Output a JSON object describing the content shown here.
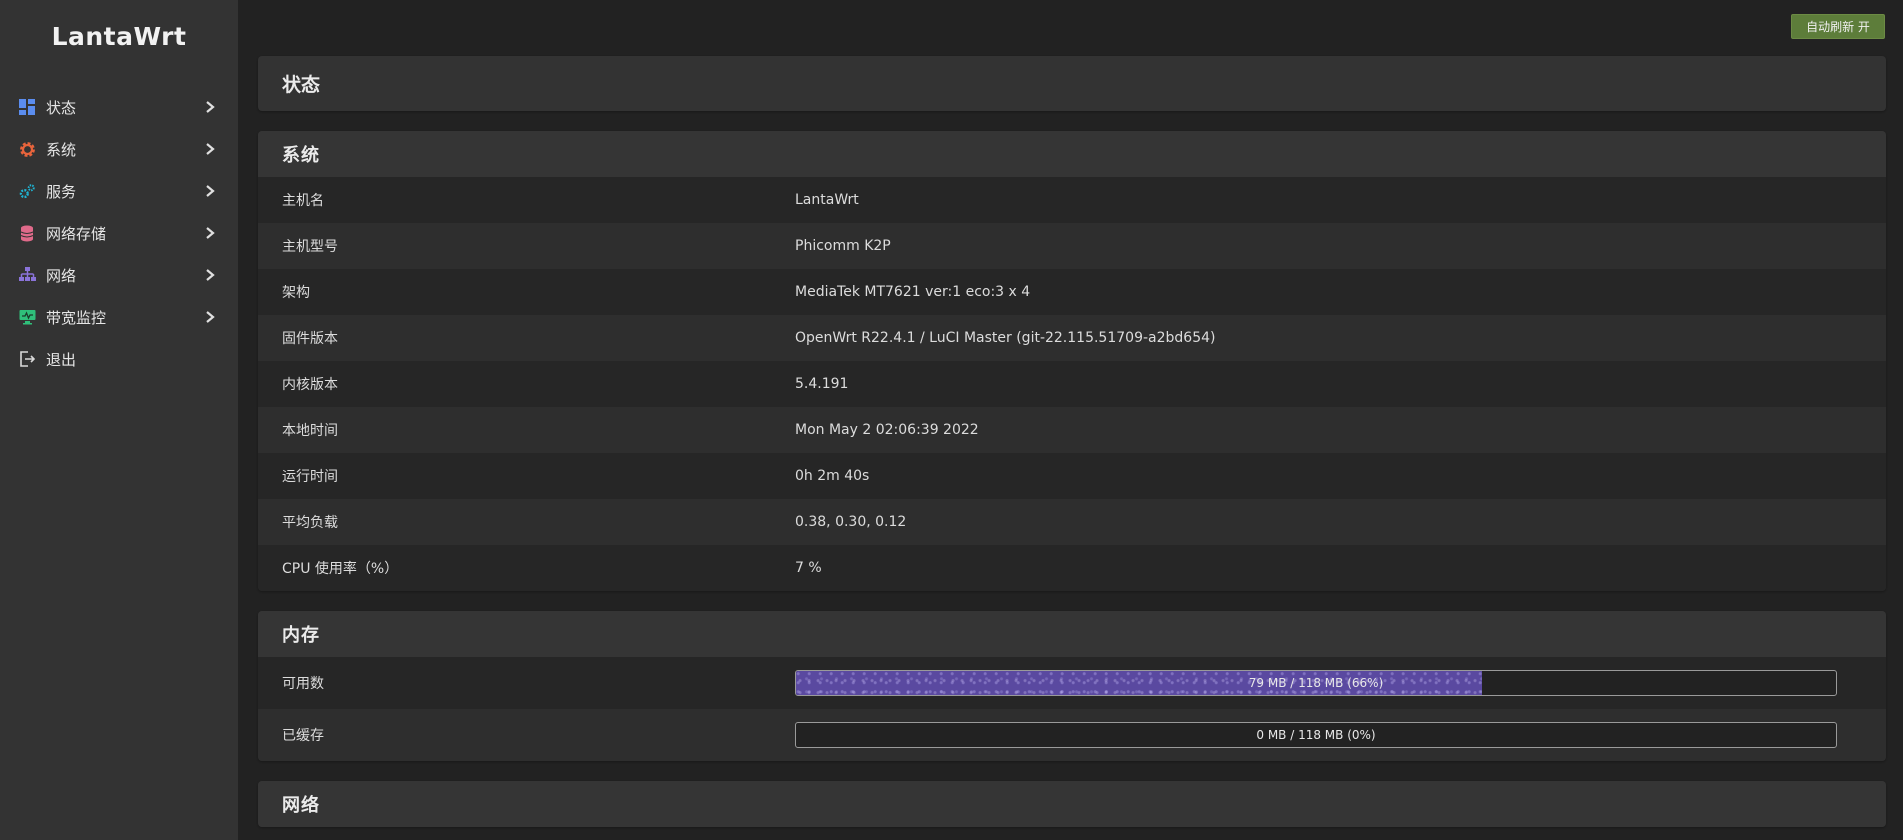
{
  "app": {
    "logo": "LantaWrt",
    "refresh_button": "自动刷新 开"
  },
  "sidebar": {
    "items": [
      {
        "label": "状态",
        "icon": "dashboard-icon",
        "color": "#5b8def",
        "has_submenu": true
      },
      {
        "label": "系统",
        "icon": "gear-icon",
        "color": "#e8643c",
        "has_submenu": true
      },
      {
        "label": "服务",
        "icon": "cogs-icon",
        "color": "#1fb5d4",
        "has_submenu": true
      },
      {
        "label": "网络存储",
        "icon": "database-icon",
        "color": "#e06a8a",
        "has_submenu": true
      },
      {
        "label": "网络",
        "icon": "sitemap-icon",
        "color": "#8a73d9",
        "has_submenu": true
      },
      {
        "label": "带宽监控",
        "icon": "monitor-icon",
        "color": "#2fbf7a",
        "has_submenu": true
      },
      {
        "label": "退出",
        "icon": "logout-icon",
        "color": "#d9d9d9",
        "has_submenu": false
      }
    ]
  },
  "page": {
    "title": "状态"
  },
  "system": {
    "title": "系统",
    "rows": [
      {
        "key": "主机名",
        "value": "LantaWrt"
      },
      {
        "key": "主机型号",
        "value": "Phicomm K2P"
      },
      {
        "key": "架构",
        "value": "MediaTek MT7621 ver:1 eco:3 x 4"
      },
      {
        "key": "固件版本",
        "value": "OpenWrt R22.4.1 / LuCI Master (git-22.115.51709-a2bd654)"
      },
      {
        "key": "内核版本",
        "value": "5.4.191"
      },
      {
        "key": "本地时间",
        "value": "Mon May 2 02:06:39 2022"
      },
      {
        "key": "运行时间",
        "value": "0h 2m 40s"
      },
      {
        "key": "平均负载",
        "value": "0.38, 0.30, 0.12"
      },
      {
        "key": "CPU 使用率（%）",
        "value": "7 %"
      }
    ]
  },
  "memory": {
    "title": "内存",
    "rows": [
      {
        "key": "可用数",
        "text": "79 MB / 118 MB (66%)",
        "percent": 66
      },
      {
        "key": "已缓存",
        "text": "0 MB / 118 MB (0%)",
        "percent": 0
      }
    ]
  },
  "network": {
    "title": "网络"
  }
}
